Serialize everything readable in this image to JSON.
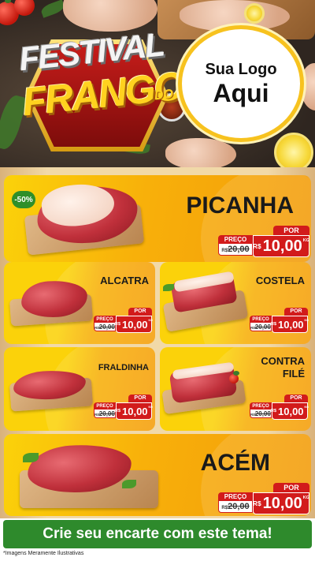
{
  "header": {
    "title_line1": "FESTIVAL",
    "title_line2": "FRANGO",
    "title_do": "DO",
    "logo_line1": "Sua Logo",
    "logo_line2": "Aqui"
  },
  "colors": {
    "brand_yellow": "#fbd20a",
    "brand_orange": "#f39c0a",
    "price_red": "#d21b1b",
    "cta_green": "#2e8a2c"
  },
  "products": [
    {
      "name": "PICANHA",
      "discount": "-50%",
      "por": "POR",
      "preco_label": "PREÇO",
      "old_currency": "R$",
      "old_price": "20,00",
      "currency": "R$",
      "price": "10,00",
      "unit": "KG"
    },
    {
      "name": "ALCATRA",
      "por": "POR",
      "preco_label": "PREÇO",
      "old_currency": "R$",
      "old_price": "20,00",
      "currency": "R$",
      "price": "10,00",
      "unit": "KG"
    },
    {
      "name": "COSTELA",
      "por": "POR",
      "preco_label": "PREÇO",
      "old_currency": "R$",
      "old_price": "20,00",
      "currency": "R$",
      "price": "10,00",
      "unit": "KG"
    },
    {
      "name": "FRALDINHA",
      "por": "POR",
      "preco_label": "PREÇO",
      "old_currency": "R$",
      "old_price": "20,00",
      "currency": "R$",
      "price": "10,00",
      "unit": "KG"
    },
    {
      "name_line1": "CONTRA",
      "name_line2": "FILÉ",
      "por": "POR",
      "preco_label": "PREÇO",
      "old_currency": "R$",
      "old_price": "20,00",
      "currency": "R$",
      "price": "10,00",
      "unit": "KG"
    },
    {
      "name": "ACÉM",
      "por": "POR",
      "preco_label": "PREÇO",
      "old_currency": "R$",
      "old_price": "20,00",
      "currency": "R$",
      "price": "10,00",
      "unit": "KG"
    }
  ],
  "footer": {
    "cta": "Crie seu encarte com este tema!",
    "disclaimer": "*Imagens Meramente Ilustrativas"
  }
}
